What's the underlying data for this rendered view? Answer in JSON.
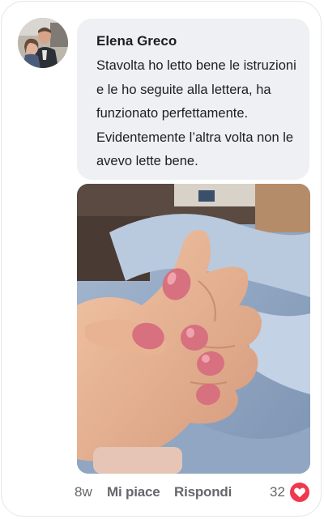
{
  "comment": {
    "author": "Elena Greco",
    "text": "Stavolta ho letto bene le istruzioni e le ho seguite alla lettera, ha funzionato perfettamente. Evidentemente l’altra volta non le avevo lette bene."
  },
  "footer": {
    "time": "8w",
    "like_label": "Mi piace",
    "reply_label": "Rispondi",
    "reaction_count": "32"
  },
  "icons": {
    "reaction": "heart-icon"
  },
  "colors": {
    "bubble_bg": "#eef0f4",
    "secondary_text": "#65676b",
    "heart": "#f0384f",
    "nail_polish": "#d7707f"
  }
}
